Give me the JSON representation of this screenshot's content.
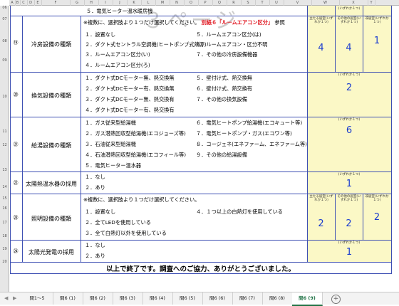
{
  "columns": [
    "A",
    "B",
    "C",
    "D",
    "E",
    "F",
    "G",
    "H",
    "I",
    "J",
    "K",
    "L",
    "M",
    "N",
    "O",
    "P",
    "Q",
    "R",
    "S",
    "T",
    "U",
    "V",
    "W",
    "X",
    "Y"
  ],
  "rows": [
    "06",
    "07",
    "08",
    "09",
    "10",
    "11",
    "12",
    "13",
    "14",
    "15",
    "16",
    "17",
    "18",
    "19",
    "20"
  ],
  "watermark": "３ページ",
  "top_partial": "５．電気ヒーター温水暖房機",
  "header_answer_labels": [
    "(いずれか１つ)",
    "(いずれか１つ)"
  ],
  "sections": [
    {
      "num": "⑲",
      "title": "冷房設備の種類",
      "note_prefix": "※複数に、選択肢より１つだけ選択してください。",
      "note_red": "別紙６「ルームエアコン区分」",
      "note_suffix": "参照",
      "options_left": [
        "１．設置なし",
        "２．ダクト式セントラル空調機(ヒートポンプ式熱源)",
        "３．ルームエアコン区分(い)",
        "４．ルームエアコン区分(ろ)"
      ],
      "options_right": [
        "５．ルームエアコン区分(は)",
        "６．ルームエアコン・区分不明",
        "７．その他の冷房設備機器"
      ],
      "answer_headers": [
        "主たる居室(いずれか１つ)",
        "その他の居室(いずれか１つ)",
        "非居室(いずれか１つ)"
      ],
      "answers": [
        "4",
        "4",
        "1"
      ]
    },
    {
      "num": "⑳",
      "title": "換気設備の種類",
      "options_left": [
        "１．ダクト式DCモーター無、熱交換無",
        "２．ダクト式DCモーター有、熱交換無",
        "３．ダクト式DCモーター無、熱交換有",
        "４．ダクト式DCモーター有、熱交換有"
      ],
      "options_right": [
        "５．壁付け式、熱交換無",
        "６．壁付け式、熱交換有",
        "７．その他の換気設備"
      ],
      "answer_header": "(いずれか１つ)",
      "answer": "2"
    },
    {
      "num": "㉑",
      "title": "給湯設備の種類",
      "options_left": [
        "１．ガス従来型給湯機",
        "２．ガス潜熱回収型給湯機(エコジョーズ等)",
        "３．石油従来型給湯機",
        "４．石油潜熱回収型給湯機(エコフィール等)",
        "５．電気ヒーター温水器"
      ],
      "options_right": [
        "６．電気ヒートポンプ給湯機(エコキュート等)",
        "７．電気ヒートポンプ・ガス(エコワン等)",
        "８．コージェネ(エネファーム、エネファーム等)",
        "９．その他の給湯設備"
      ],
      "answer_header": "(いずれか１つ)",
      "answer": "6"
    },
    {
      "num": "㉒",
      "title": "太陽熱温水器の採用",
      "options_left": [
        "１．なし",
        "２．あり"
      ],
      "answer_header": "(いずれか１つ)",
      "answer": "1"
    },
    {
      "num": "㉓",
      "title": "照明設備の種類",
      "note_prefix": "※複数に、選択肢より１つだけ選択してください。",
      "options_left": [
        "１．設置なし",
        "２．全てLEDを使用している",
        "３．全て白熱灯以外を使用している"
      ],
      "options_right": [
        "４．１つ以上の白熱灯を使用している"
      ],
      "answer_headers": [
        "主たる居室(いずれか１つ)",
        "その他の居室(いずれか１つ)",
        "非居室(いずれか１つ)"
      ],
      "answers": [
        "2",
        "2",
        "2"
      ]
    },
    {
      "num": "㉔",
      "title": "太陽光発電の採用",
      "options_left": [
        "１．なし",
        "２．あり"
      ],
      "answer_header": "(いずれか１つ)",
      "answer": "1"
    }
  ],
  "closing": "以上で終了です。調査へのご協力、ありがとうございました。",
  "tabs": [
    "問1～5",
    "問6 (1)",
    "問6 (2)",
    "問6 (3)",
    "問6 (4)",
    "問6 (5)",
    "問6 (6)",
    "問6 (7)",
    "問6 (8)",
    "問6 (9)"
  ],
  "active_tab": "問6 (9)",
  "colors": {
    "accent_blue": "#3d4fb3",
    "answer_blue": "#1a3ccf",
    "answer_bg": "#fbf8c6",
    "note_red": "#e0141e",
    "tab_active": "#217346"
  }
}
